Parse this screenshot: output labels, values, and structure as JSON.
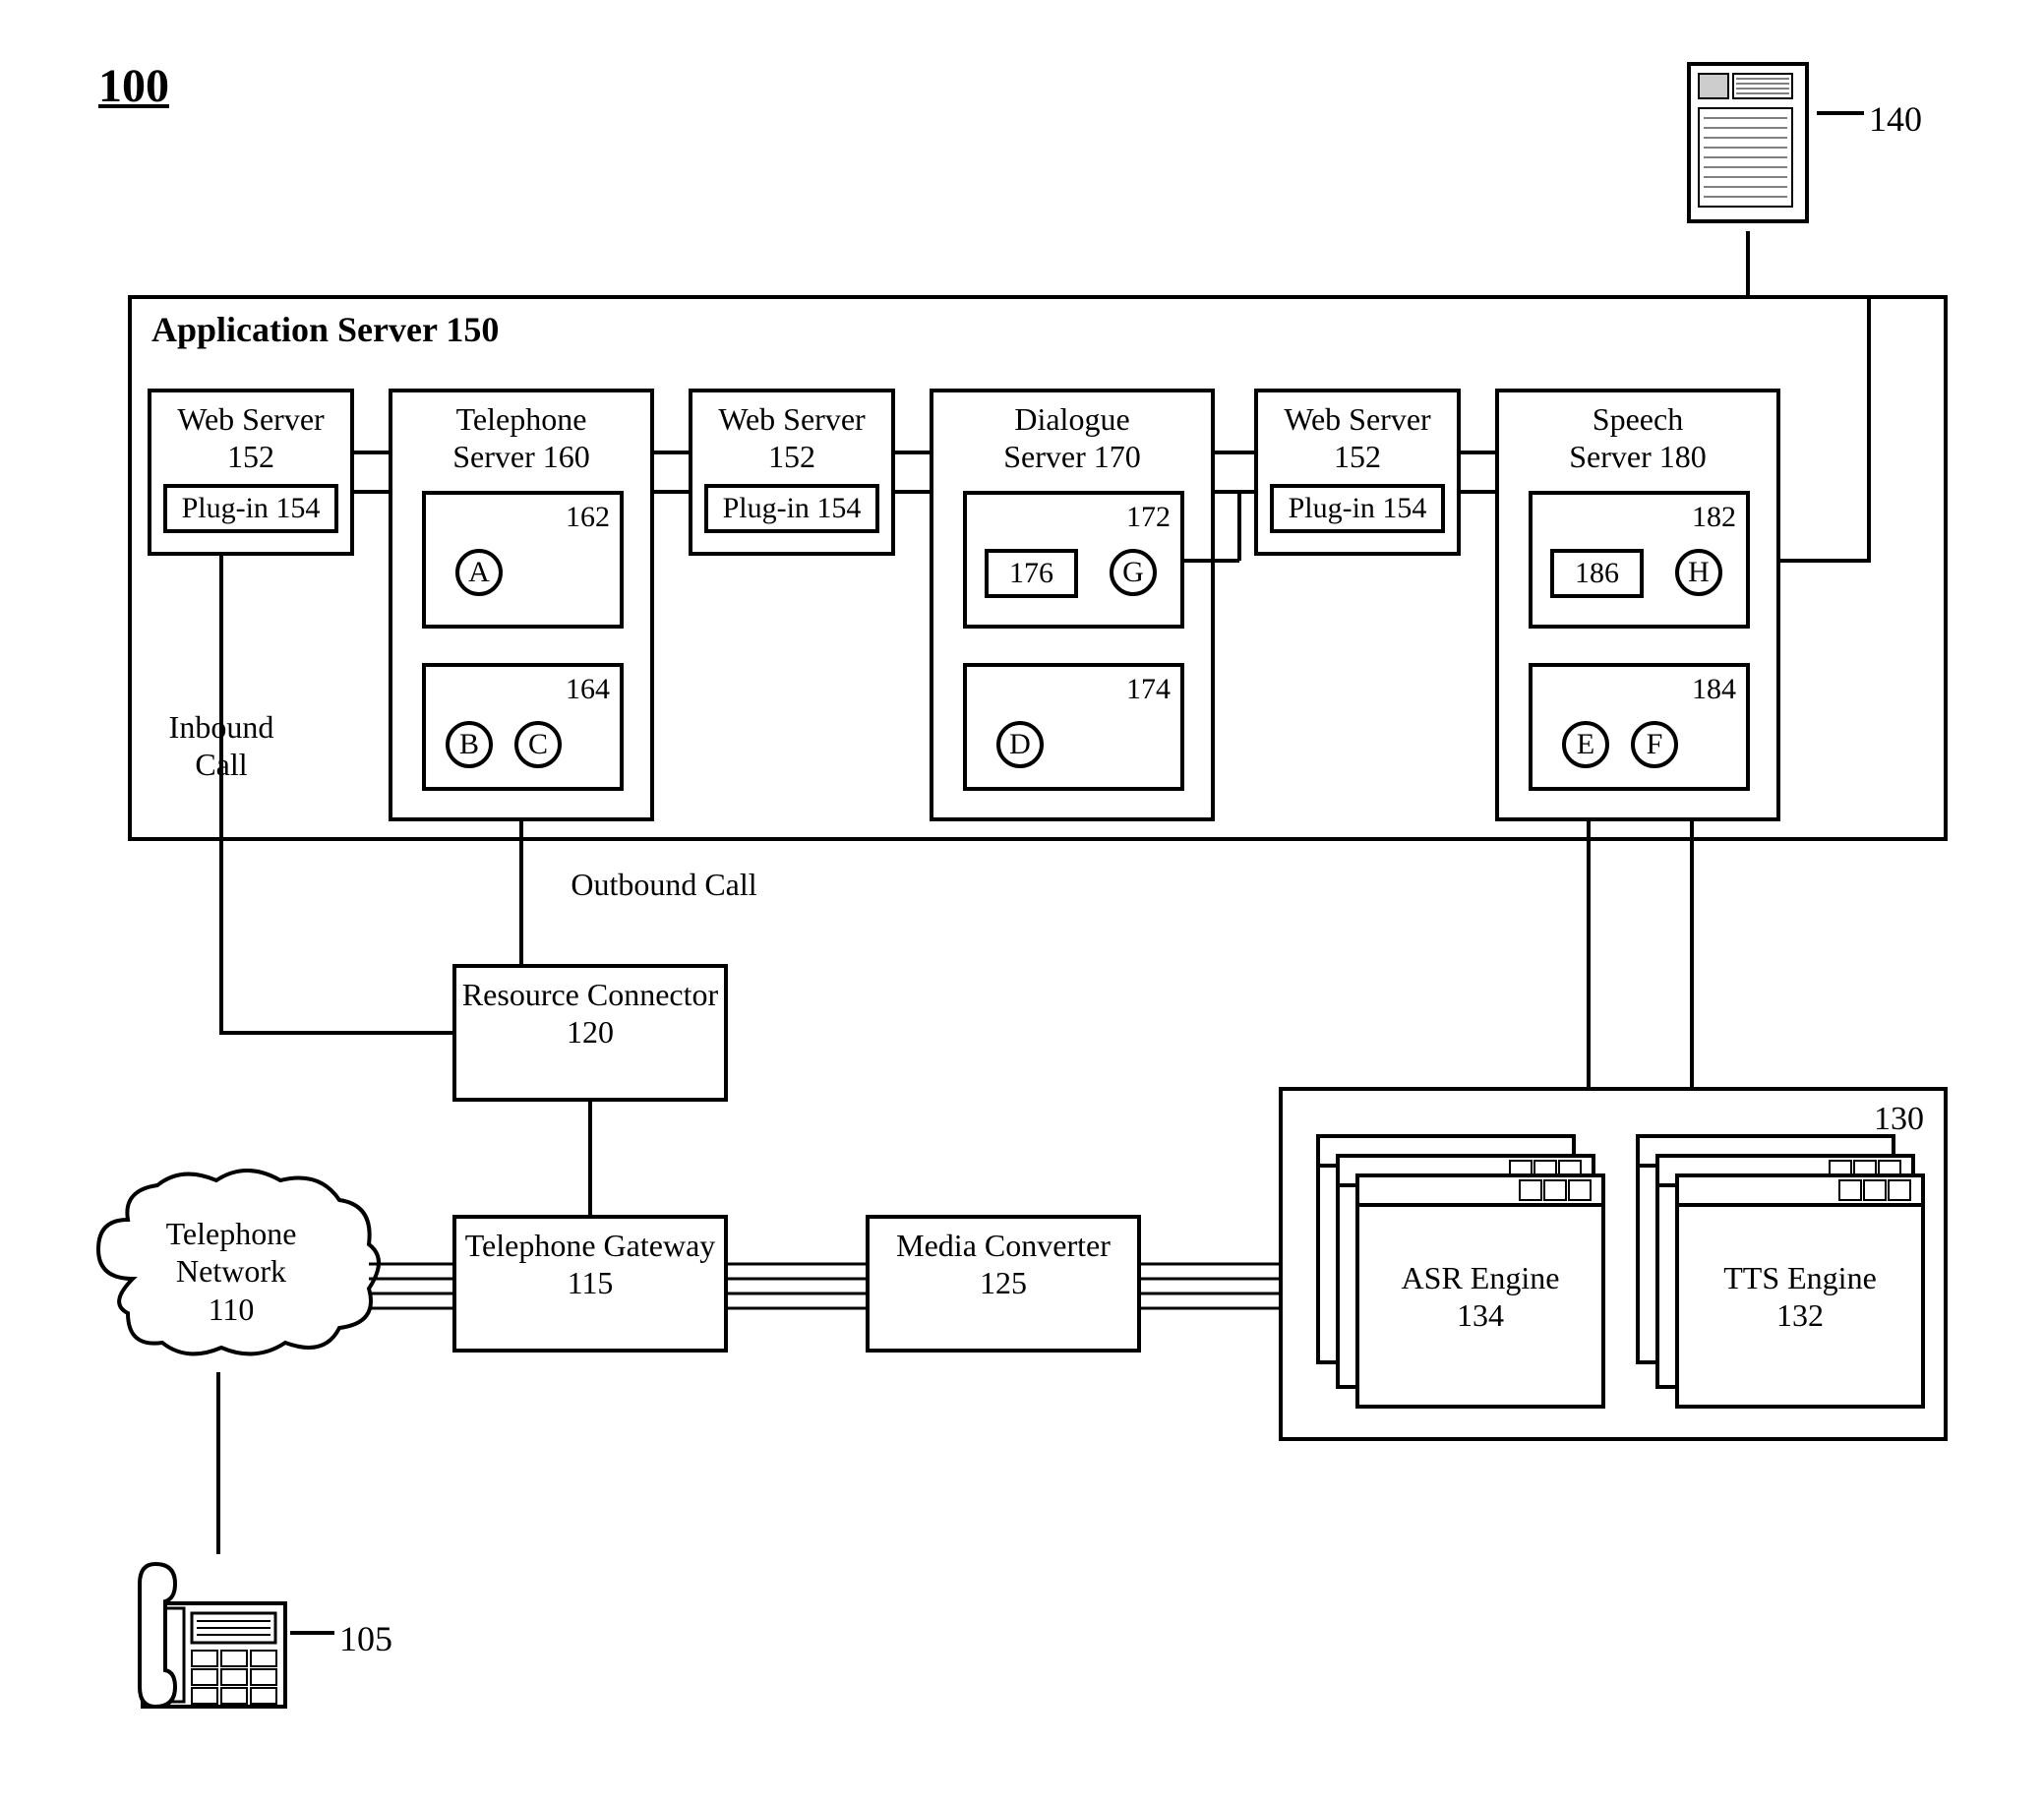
{
  "figure_number": "100",
  "app_server_title": "Application Server 150",
  "web_server_title": "Web Server",
  "web_server_num": "152",
  "plugin_label": "Plug-in 154",
  "telephone_server_title": "Telephone",
  "telephone_server_sub": "Server 160",
  "tel_box1_num": "162",
  "tel_box2_num": "164",
  "dialogue_server_title": "Dialogue",
  "dialogue_server_sub": "Server 170",
  "dlg_box1_num": "172",
  "dlg_box1_inner": "176",
  "dlg_box2_num": "174",
  "speech_server_title": "Speech",
  "speech_server_sub": "Server 180",
  "sp_box1_num": "182",
  "sp_box1_inner": "186",
  "sp_box2_num": "184",
  "inbound_call": "Inbound Call",
  "outbound_call": "Outbound Call",
  "resource_connector": "Resource Connector",
  "resource_connector_num": "120",
  "telephone_network": "Telephone Network",
  "telephone_network_num": "110",
  "telephone_gateway": "Telephone Gateway",
  "telephone_gateway_num": "115",
  "media_converter": "Media Converter",
  "media_converter_num": "125",
  "asr_engine": "ASR Engine",
  "asr_engine_num": "134",
  "tts_engine": "TTS Engine",
  "tts_engine_num": "132",
  "engine_box_num": "130",
  "server_ref_num": "140",
  "phone_ref_num": "105",
  "letters": {
    "A": "A",
    "B": "B",
    "C": "C",
    "D": "D",
    "E": "E",
    "F": "F",
    "G": "G",
    "H": "H"
  }
}
